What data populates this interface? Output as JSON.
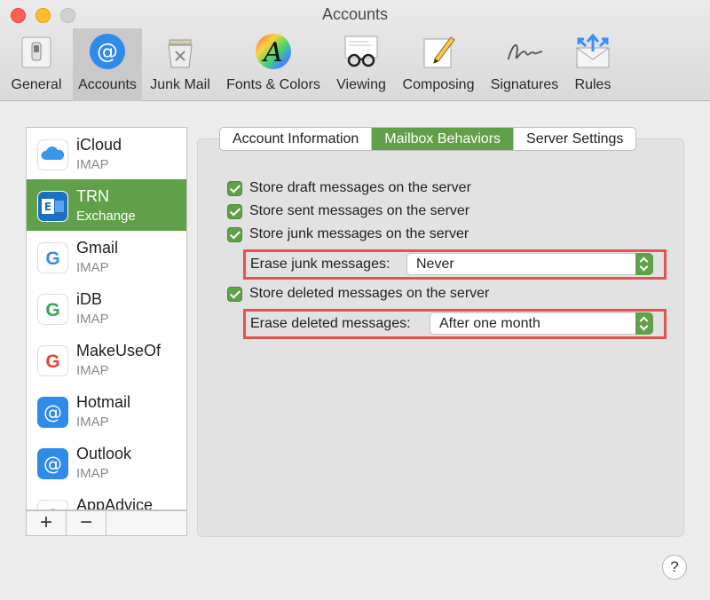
{
  "window": {
    "title": "Accounts"
  },
  "toolbar": {
    "items": [
      {
        "label": "General",
        "icon": "general-switch-icon"
      },
      {
        "label": "Accounts",
        "icon": "at-sign-icon",
        "active": true
      },
      {
        "label": "Junk Mail",
        "icon": "junk-bin-icon"
      },
      {
        "label": "Fonts & Colors",
        "icon": "font-color-wheel-icon"
      },
      {
        "label": "Viewing",
        "icon": "glasses-icon"
      },
      {
        "label": "Composing",
        "icon": "pencil-paper-icon"
      },
      {
        "label": "Signatures",
        "icon": "signature-icon"
      },
      {
        "label": "Rules",
        "icon": "rules-envelope-icon"
      }
    ]
  },
  "accounts": [
    {
      "name": "iCloud",
      "type": "IMAP",
      "icon": "icloud-icon"
    },
    {
      "name": "TRN",
      "type": "Exchange",
      "icon": "exchange-icon",
      "selected": true
    },
    {
      "name": "Gmail",
      "type": "IMAP",
      "icon": "google-icon"
    },
    {
      "name": "iDB",
      "type": "IMAP",
      "icon": "google-icon"
    },
    {
      "name": "MakeUseOf",
      "type": "IMAP",
      "icon": "google-icon"
    },
    {
      "name": "Hotmail",
      "type": "IMAP",
      "icon": "at-sign-icon"
    },
    {
      "name": "Outlook",
      "type": "IMAP",
      "icon": "at-sign-icon"
    },
    {
      "name": "AppAdvice",
      "type": "",
      "icon": "google-icon"
    }
  ],
  "list_footer": {
    "add": "+",
    "remove": "−"
  },
  "tabs": [
    {
      "label": "Account Information"
    },
    {
      "label": "Mailbox Behaviors",
      "active": true
    },
    {
      "label": "Server Settings"
    }
  ],
  "options": {
    "store_drafts": {
      "label": "Store draft messages on the server",
      "checked": true
    },
    "store_sent": {
      "label": "Store sent messages on the server",
      "checked": true
    },
    "store_junk": {
      "label": "Store junk messages on the server",
      "checked": true
    },
    "erase_junk": {
      "label": "Erase junk messages:",
      "value": "Never"
    },
    "store_deleted": {
      "label": "Store deleted messages on the server",
      "checked": true
    },
    "erase_deleted": {
      "label": "Erase deleted messages:",
      "value": "After one month"
    }
  },
  "help": {
    "label": "?"
  },
  "colors": {
    "accent": "#5fa049",
    "highlight": "#e5524f",
    "background": "#ececec"
  }
}
